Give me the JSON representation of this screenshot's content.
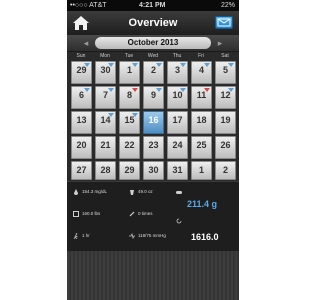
{
  "status_bar": {
    "carrier": "••○○○ AT&T",
    "time": "4:21 PM",
    "battery": "22%"
  },
  "header": {
    "title": "Overview",
    "home_icon": "home-icon",
    "mail_icon": "mail-icon"
  },
  "calendar": {
    "month_label": "October 2013",
    "prev_label": "◂",
    "next_label": "▸",
    "weekdays": [
      "Sun",
      "Mon",
      "Tue",
      "Wed",
      "Thu",
      "Fri",
      "Sat"
    ],
    "weeks": [
      [
        "29",
        "30",
        "1",
        "2",
        "3",
        "4",
        "5"
      ],
      [
        "6",
        "7",
        "8",
        "9",
        "10",
        "11",
        "12"
      ],
      [
        "13",
        "14",
        "15",
        "16",
        "17",
        "18",
        "19"
      ],
      [
        "20",
        "21",
        "22",
        "23",
        "24",
        "25",
        "26"
      ],
      [
        "27",
        "28",
        "29",
        "30",
        "31",
        "1",
        "2"
      ]
    ],
    "today": "16"
  },
  "stats": {
    "glucose": "154.3 mg/dL",
    "fluid": "49.0 oz",
    "weight": "160.0 lbs",
    "count": "0 times",
    "activity": "1 hr",
    "blood_pressure": "118/75 mmHg",
    "carbs": "211.4 g",
    "calories": "1616.0"
  },
  "colors": {
    "accent_blue": "#5aa9ec",
    "marker_red": "#d34848"
  }
}
